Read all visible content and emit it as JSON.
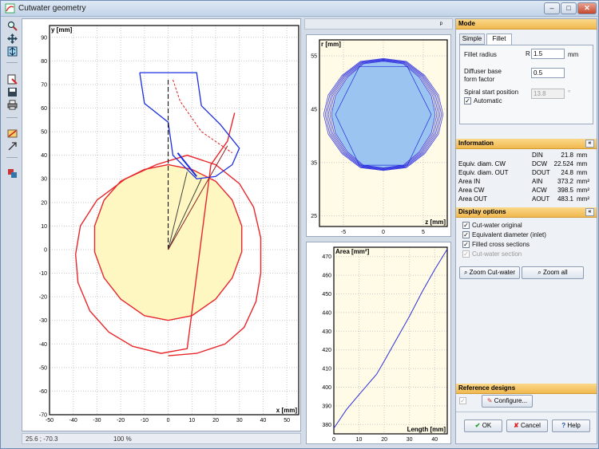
{
  "window": {
    "title": "Cutwater geometry",
    "buttons": {
      "minimize": "–",
      "maximize": "□",
      "close": "✕"
    }
  },
  "toolbar": {
    "icons": [
      "zoom-icon",
      "pan-icon",
      "fit-icon",
      "export-icon",
      "save-icon",
      "print-icon",
      "settings-icon",
      "arrow-icon",
      "layers-icon"
    ]
  },
  "status": {
    "coords": "25.6 ; -70.3",
    "zoom": "100 %"
  },
  "mid": {
    "pin": "ᵖ"
  },
  "mode": {
    "title": "Mode",
    "tabs": [
      "Simple",
      "Fillet"
    ],
    "fillet_radius_label": "Fillet radius",
    "fillet_radius_prefix": "R",
    "fillet_radius_value": "1.5",
    "fillet_radius_unit": "mm",
    "diffuser_label_1": "Diffuser base",
    "diffuser_label_2": "form factor",
    "diffuser_value": "0.5",
    "spiral_label": "Spiral start position",
    "spiral_value": "13.8",
    "spiral_unit": "°",
    "automatic_label": "Automatic"
  },
  "information": {
    "title": "Information",
    "collapse": "«",
    "rows": [
      {
        "label": "",
        "sym": "DIN",
        "value": "21.8",
        "unit": "mm"
      },
      {
        "label": "Equiv. diam. CW",
        "sym": "DCW",
        "value": "22.524",
        "unit": "mm"
      },
      {
        "label": "Equiv. diam. OUT",
        "sym": "DOUT",
        "value": "24.8",
        "unit": "mm"
      },
      {
        "label": "Area IN",
        "sym": "AIN",
        "value": "373.2",
        "unit": "mm²"
      },
      {
        "label": "Area CW",
        "sym": "ACW",
        "value": "398.5",
        "unit": "mm²"
      },
      {
        "label": "Area OUT",
        "sym": "AOUT",
        "value": "483.1",
        "unit": "mm²"
      }
    ]
  },
  "display": {
    "title": "Display options",
    "collapse": "«",
    "options": [
      "Cut-water original",
      "Equivalent diameter (inlet)",
      "Filled cross sections",
      "Cut-water section"
    ],
    "zoom_cutwater": "Zoom Cut-water",
    "zoom_all": "Zoom all"
  },
  "reference": {
    "title": "Reference designs",
    "configure": "Configure..."
  },
  "footer": {
    "ok": "OK",
    "cancel": "Cancel",
    "help": "Help"
  },
  "chart_data": [
    {
      "type": "line",
      "title": "",
      "xlabel": "x [mm]",
      "ylabel": "y [mm]",
      "xlim": [
        -50,
        55
      ],
      "ylim": [
        -70,
        95
      ],
      "xticks": [
        -50,
        -40,
        -30,
        -20,
        -10,
        0,
        10,
        20,
        30,
        40,
        50
      ],
      "yticks": [
        -70,
        -60,
        -50,
        -40,
        -30,
        -20,
        -10,
        0,
        10,
        20,
        30,
        40,
        50,
        60,
        70,
        80,
        90
      ],
      "grid": true,
      "series": [
        {
          "color": "#e8262b",
          "x": [
            0,
            12,
            24,
            32,
            37,
            39,
            39,
            36,
            30,
            20,
            8,
            -5,
            -18,
            -30,
            -37,
            -39,
            -38,
            -33,
            -25,
            -15,
            -3,
            8,
            18,
            25,
            28
          ],
          "y": [
            -45,
            -44,
            -40,
            -33,
            -22,
            -10,
            5,
            18,
            28,
            36,
            40,
            36,
            30,
            21,
            10,
            -2,
            -14,
            -26,
            -35,
            -41,
            -44,
            -42,
            36,
            46,
            58
          ]
        },
        {
          "color": "#e8262b",
          "x": [
            0,
            10,
            20,
            27,
            31,
            31,
            27,
            20,
            10,
            0,
            -10,
            -20,
            -27,
            -31,
            -31,
            -27,
            -20,
            -10,
            0
          ],
          "y": [
            36,
            34,
            29,
            21,
            10,
            -1,
            -12,
            -21,
            -28,
            -30,
            -28,
            -21,
            -12,
            -1,
            10,
            21,
            29,
            34,
            36
          ]
        }
      ]
    },
    {
      "type": "line",
      "title": "",
      "xlabel": "z [mm]",
      "ylabel": "r [mm]",
      "xlim": [
        -8,
        8
      ],
      "ylim": [
        23,
        58
      ],
      "xticks": [
        -5,
        0,
        5
      ],
      "yticks": [
        25,
        35,
        45,
        55
      ],
      "grid": true,
      "series": [
        {
          "color": "#2a2ee0",
          "x": [
            -6.5,
            -6,
            -4.5,
            -2.5,
            0,
            2.5,
            4.5,
            6,
            6.5,
            6,
            4.5,
            2.5,
            0,
            -2.5,
            -4.5,
            -6,
            -6.5
          ],
          "y": [
            44,
            47.5,
            51,
            53.5,
            54,
            53.5,
            51,
            47.5,
            44,
            40.5,
            37,
            34.5,
            34,
            34.5,
            37,
            40.5,
            44
          ]
        }
      ]
    },
    {
      "type": "line",
      "title": "",
      "xlabel": "Length [mm]",
      "ylabel": "Area [mm²]",
      "xlim": [
        0,
        45
      ],
      "ylim": [
        375,
        475
      ],
      "xticks": [
        0,
        10,
        20,
        30,
        40
      ],
      "yticks": [
        380,
        390,
        400,
        410,
        420,
        430,
        440,
        450,
        460,
        470
      ],
      "grid": true,
      "series": [
        {
          "color": "#2a2ee0",
          "x": [
            0,
            5,
            10,
            17,
            20,
            25,
            30,
            35,
            40,
            45
          ],
          "y": [
            378,
            388,
            396,
            407,
            414,
            426,
            438,
            451,
            463,
            474
          ]
        }
      ]
    }
  ]
}
